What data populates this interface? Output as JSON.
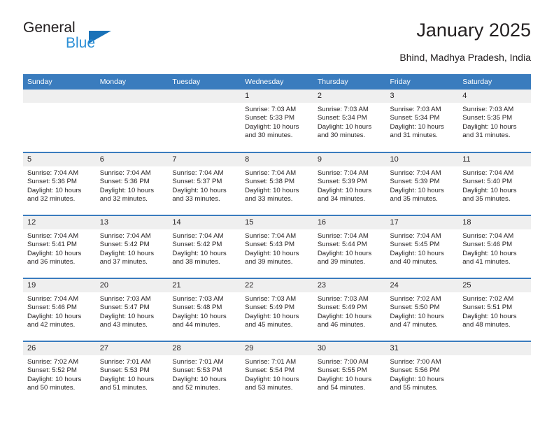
{
  "brand": {
    "name_top": "General",
    "name_bottom": "Blue",
    "triangle_color": "#1a72b8",
    "blue_text_color": "#2b8fd6"
  },
  "header": {
    "title": "January 2025",
    "subtitle": "Bhind, Madhya Pradesh, India"
  },
  "colors": {
    "header_row": "#3a7cbe",
    "daynum_band": "#efefef",
    "text": "#231f20"
  },
  "calendar": {
    "weekday_headers": [
      "Sunday",
      "Monday",
      "Tuesday",
      "Wednesday",
      "Thursday",
      "Friday",
      "Saturday"
    ],
    "weeks": [
      [
        {
          "day": "",
          "empty": true
        },
        {
          "day": "",
          "empty": true
        },
        {
          "day": "",
          "empty": true
        },
        {
          "day": "1",
          "sunrise": "Sunrise: 7:03 AM",
          "sunset": "Sunset: 5:33 PM",
          "daylight": "Daylight: 10 hours and 30 minutes."
        },
        {
          "day": "2",
          "sunrise": "Sunrise: 7:03 AM",
          "sunset": "Sunset: 5:34 PM",
          "daylight": "Daylight: 10 hours and 30 minutes."
        },
        {
          "day": "3",
          "sunrise": "Sunrise: 7:03 AM",
          "sunset": "Sunset: 5:34 PM",
          "daylight": "Daylight: 10 hours and 31 minutes."
        },
        {
          "day": "4",
          "sunrise": "Sunrise: 7:03 AM",
          "sunset": "Sunset: 5:35 PM",
          "daylight": "Daylight: 10 hours and 31 minutes."
        }
      ],
      [
        {
          "day": "5",
          "sunrise": "Sunrise: 7:04 AM",
          "sunset": "Sunset: 5:36 PM",
          "daylight": "Daylight: 10 hours and 32 minutes."
        },
        {
          "day": "6",
          "sunrise": "Sunrise: 7:04 AM",
          "sunset": "Sunset: 5:36 PM",
          "daylight": "Daylight: 10 hours and 32 minutes."
        },
        {
          "day": "7",
          "sunrise": "Sunrise: 7:04 AM",
          "sunset": "Sunset: 5:37 PM",
          "daylight": "Daylight: 10 hours and 33 minutes."
        },
        {
          "day": "8",
          "sunrise": "Sunrise: 7:04 AM",
          "sunset": "Sunset: 5:38 PM",
          "daylight": "Daylight: 10 hours and 33 minutes."
        },
        {
          "day": "9",
          "sunrise": "Sunrise: 7:04 AM",
          "sunset": "Sunset: 5:39 PM",
          "daylight": "Daylight: 10 hours and 34 minutes."
        },
        {
          "day": "10",
          "sunrise": "Sunrise: 7:04 AM",
          "sunset": "Sunset: 5:39 PM",
          "daylight": "Daylight: 10 hours and 35 minutes."
        },
        {
          "day": "11",
          "sunrise": "Sunrise: 7:04 AM",
          "sunset": "Sunset: 5:40 PM",
          "daylight": "Daylight: 10 hours and 35 minutes."
        }
      ],
      [
        {
          "day": "12",
          "sunrise": "Sunrise: 7:04 AM",
          "sunset": "Sunset: 5:41 PM",
          "daylight": "Daylight: 10 hours and 36 minutes."
        },
        {
          "day": "13",
          "sunrise": "Sunrise: 7:04 AM",
          "sunset": "Sunset: 5:42 PM",
          "daylight": "Daylight: 10 hours and 37 minutes."
        },
        {
          "day": "14",
          "sunrise": "Sunrise: 7:04 AM",
          "sunset": "Sunset: 5:42 PM",
          "daylight": "Daylight: 10 hours and 38 minutes."
        },
        {
          "day": "15",
          "sunrise": "Sunrise: 7:04 AM",
          "sunset": "Sunset: 5:43 PM",
          "daylight": "Daylight: 10 hours and 39 minutes."
        },
        {
          "day": "16",
          "sunrise": "Sunrise: 7:04 AM",
          "sunset": "Sunset: 5:44 PM",
          "daylight": "Daylight: 10 hours and 39 minutes."
        },
        {
          "day": "17",
          "sunrise": "Sunrise: 7:04 AM",
          "sunset": "Sunset: 5:45 PM",
          "daylight": "Daylight: 10 hours and 40 minutes."
        },
        {
          "day": "18",
          "sunrise": "Sunrise: 7:04 AM",
          "sunset": "Sunset: 5:46 PM",
          "daylight": "Daylight: 10 hours and 41 minutes."
        }
      ],
      [
        {
          "day": "19",
          "sunrise": "Sunrise: 7:04 AM",
          "sunset": "Sunset: 5:46 PM",
          "daylight": "Daylight: 10 hours and 42 minutes."
        },
        {
          "day": "20",
          "sunrise": "Sunrise: 7:03 AM",
          "sunset": "Sunset: 5:47 PM",
          "daylight": "Daylight: 10 hours and 43 minutes."
        },
        {
          "day": "21",
          "sunrise": "Sunrise: 7:03 AM",
          "sunset": "Sunset: 5:48 PM",
          "daylight": "Daylight: 10 hours and 44 minutes."
        },
        {
          "day": "22",
          "sunrise": "Sunrise: 7:03 AM",
          "sunset": "Sunset: 5:49 PM",
          "daylight": "Daylight: 10 hours and 45 minutes."
        },
        {
          "day": "23",
          "sunrise": "Sunrise: 7:03 AM",
          "sunset": "Sunset: 5:49 PM",
          "daylight": "Daylight: 10 hours and 46 minutes."
        },
        {
          "day": "24",
          "sunrise": "Sunrise: 7:02 AM",
          "sunset": "Sunset: 5:50 PM",
          "daylight": "Daylight: 10 hours and 47 minutes."
        },
        {
          "day": "25",
          "sunrise": "Sunrise: 7:02 AM",
          "sunset": "Sunset: 5:51 PM",
          "daylight": "Daylight: 10 hours and 48 minutes."
        }
      ],
      [
        {
          "day": "26",
          "sunrise": "Sunrise: 7:02 AM",
          "sunset": "Sunset: 5:52 PM",
          "daylight": "Daylight: 10 hours and 50 minutes."
        },
        {
          "day": "27",
          "sunrise": "Sunrise: 7:01 AM",
          "sunset": "Sunset: 5:53 PM",
          "daylight": "Daylight: 10 hours and 51 minutes."
        },
        {
          "day": "28",
          "sunrise": "Sunrise: 7:01 AM",
          "sunset": "Sunset: 5:53 PM",
          "daylight": "Daylight: 10 hours and 52 minutes."
        },
        {
          "day": "29",
          "sunrise": "Sunrise: 7:01 AM",
          "sunset": "Sunset: 5:54 PM",
          "daylight": "Daylight: 10 hours and 53 minutes."
        },
        {
          "day": "30",
          "sunrise": "Sunrise: 7:00 AM",
          "sunset": "Sunset: 5:55 PM",
          "daylight": "Daylight: 10 hours and 54 minutes."
        },
        {
          "day": "31",
          "sunrise": "Sunrise: 7:00 AM",
          "sunset": "Sunset: 5:56 PM",
          "daylight": "Daylight: 10 hours and 55 minutes."
        },
        {
          "day": "",
          "empty": true
        }
      ]
    ]
  }
}
